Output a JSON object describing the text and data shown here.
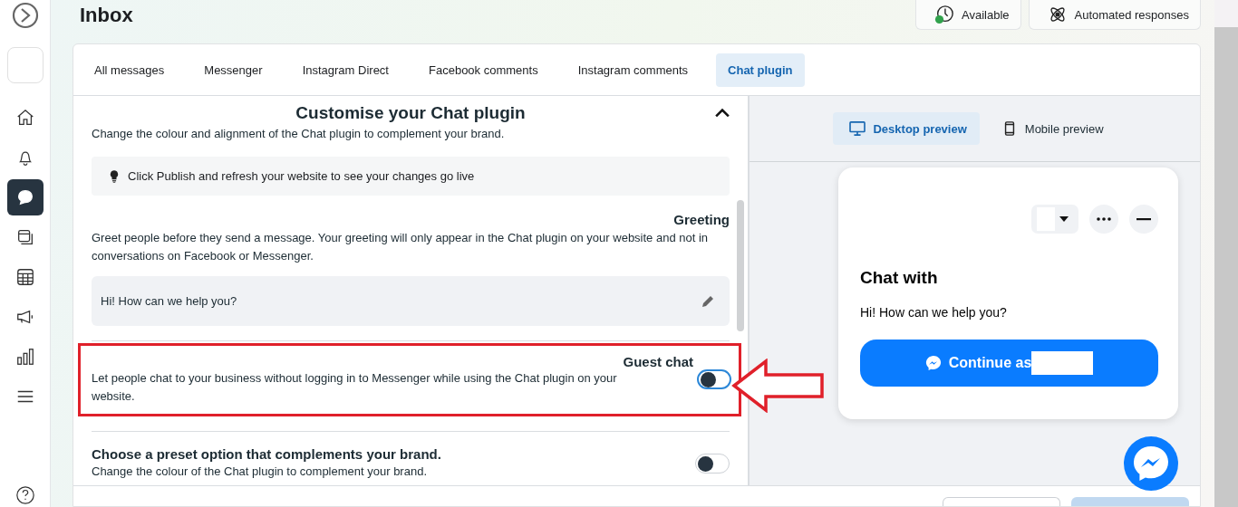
{
  "sidebar": {
    "items": [
      {
        "kind": "home",
        "selected": false
      },
      {
        "kind": "bell",
        "selected": false
      },
      {
        "kind": "chat",
        "selected": true
      },
      {
        "kind": "pages",
        "selected": false
      },
      {
        "kind": "table",
        "selected": false
      },
      {
        "kind": "megaphone",
        "selected": false
      },
      {
        "kind": "chart",
        "selected": false
      },
      {
        "kind": "menu",
        "selected": false
      }
    ]
  },
  "header": {
    "title": "Inbox",
    "buttons": [
      {
        "kind": "status",
        "label": "Available"
      },
      {
        "kind": "automation",
        "label": "Automated responses"
      }
    ]
  },
  "tabs": [
    {
      "label": "All messages",
      "selected": false
    },
    {
      "label": "Messenger",
      "selected": false
    },
    {
      "label": "Instagram Direct",
      "selected": false
    },
    {
      "label": "Facebook comments",
      "selected": false
    },
    {
      "label": "Instagram comments",
      "selected": false
    },
    {
      "label": "Chat plugin",
      "selected": true
    }
  ],
  "settings": {
    "title": "Customise your Chat plugin",
    "expanded": true,
    "description": "Change the colour and alignment of the Chat plugin to complement your brand.",
    "tip": "Click Publish and refresh your website to see your changes go live",
    "greeting": {
      "title": "Greeting",
      "description": "Greet people before they send a message. Your greeting will only appear in the Chat plugin on your website and not in conversations on Facebook or Messenger.",
      "value": "Hi! How can we help you?"
    },
    "guest_chat": {
      "title": "Guest chat",
      "description": "Let people chat to your business without logging in to Messenger while using the Chat plugin on your website.",
      "on": false
    },
    "preset": {
      "title": "Choose a preset option that complements your brand.",
      "description": "Change the colour of the Chat plugin to complement your brand.",
      "on": false
    }
  },
  "preview": {
    "tabs": [
      {
        "kind": "desktop",
        "label": "Desktop preview",
        "selected": true
      },
      {
        "kind": "mobile",
        "label": "Mobile preview",
        "selected": false
      }
    ],
    "chat": {
      "heading": "Chat with",
      "greeting": "Hi! How can we help you?",
      "button": "Continue as"
    }
  }
}
